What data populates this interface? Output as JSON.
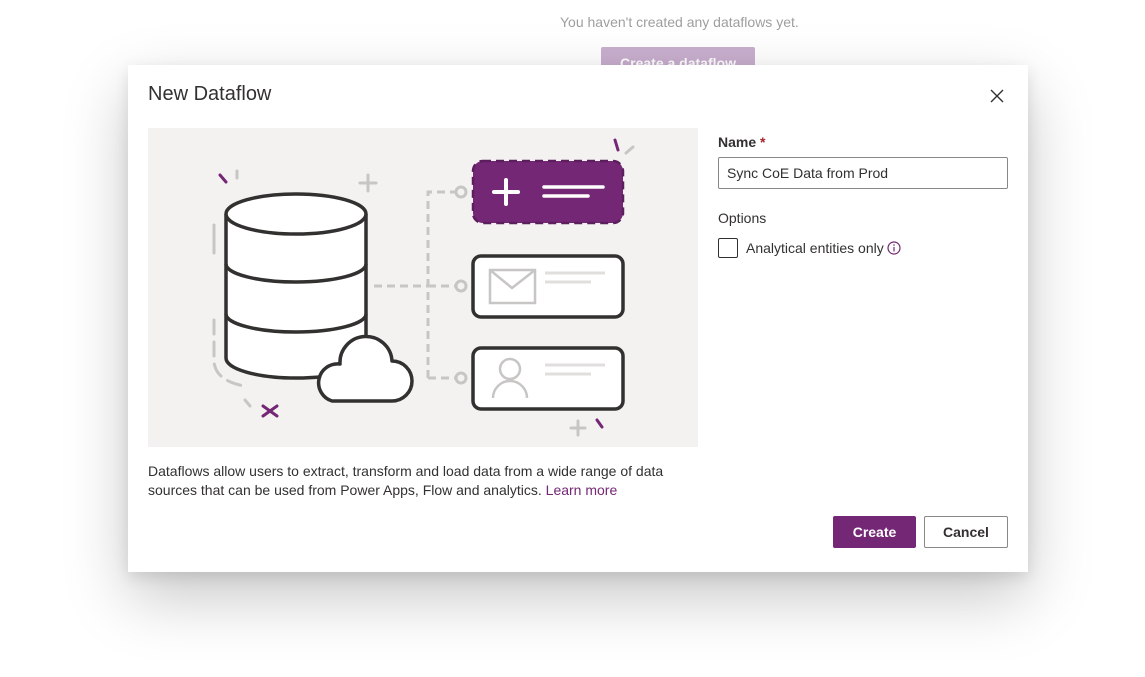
{
  "background": {
    "empty_message": "You haven't created any dataflows yet.",
    "create_button_label": "Create a dataflow"
  },
  "dialog": {
    "title": "New Dataflow",
    "close_icon": "close-icon",
    "name_label": "Name",
    "required_marker": "*",
    "name_value": "Sync CoE Data from Prod",
    "options_label": "Options",
    "analytical_option_label": "Analytical entities only",
    "analytical_option_checked": false,
    "info_icon": "info-icon",
    "description": "Dataflows allow users to extract, transform and load data from a wide range of data sources that can be used from Power Apps, Flow and analytics.",
    "learn_more_label": "Learn more",
    "create_label": "Create",
    "cancel_label": "Cancel"
  },
  "illustration": {
    "icons": [
      "database-icon",
      "cloud-icon",
      "add-entity-icon",
      "mail-icon",
      "person-icon"
    ]
  },
  "colors": {
    "accent": "#742774",
    "accent_light": "#a67ab0",
    "illustration_background": "#f3f2f1",
    "text": "#323130",
    "required": "#a4262c"
  }
}
